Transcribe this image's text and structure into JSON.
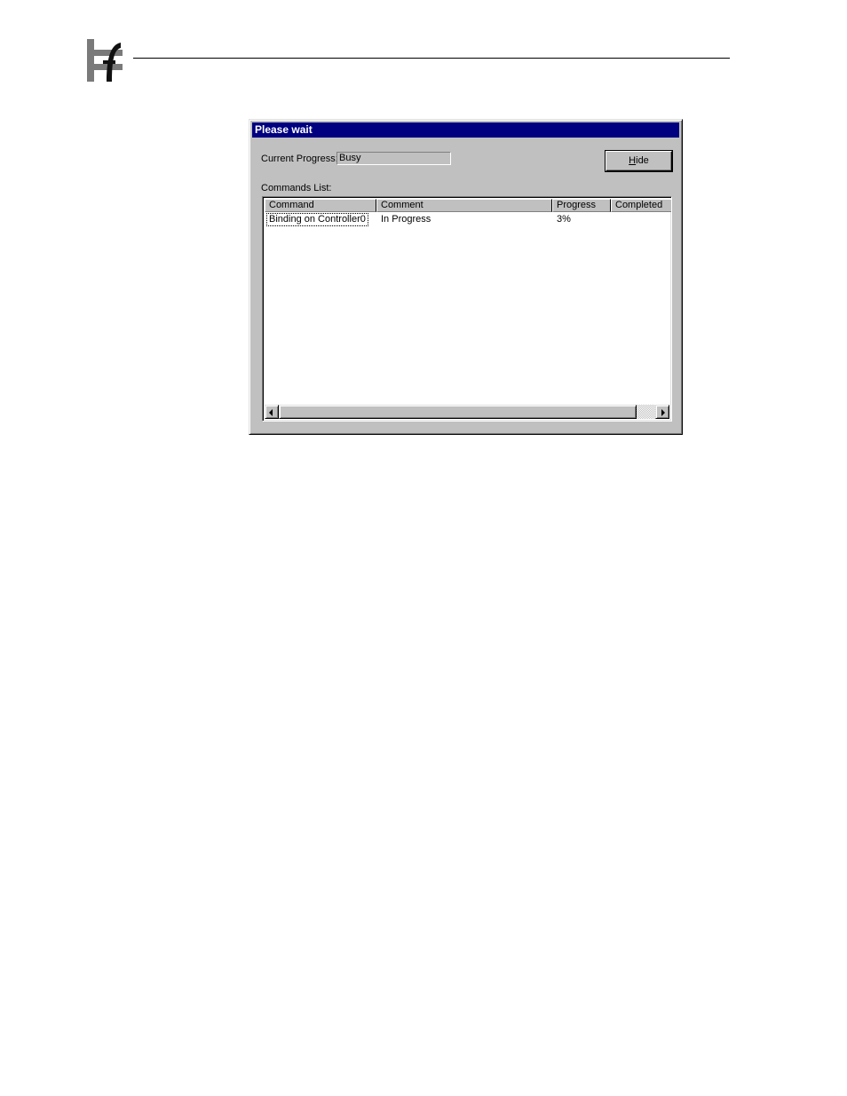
{
  "dialog": {
    "title": "Please wait",
    "current_progress_label": "Current Progress:",
    "current_progress_value": "Busy",
    "hide_button_label": "Hide",
    "hide_button_mnemonic": "H",
    "commands_list_label": "Commands List:"
  },
  "table": {
    "columns": [
      "Command",
      "Comment",
      "Progress",
      "Completed"
    ],
    "rows": [
      {
        "command": "Binding on Controller0",
        "comment": "In Progress",
        "progress": "3%",
        "completed": ""
      }
    ]
  },
  "colors": {
    "titlebar": "#000080",
    "face": "#c0c0c0"
  },
  "icons": [
    "logo-icon",
    "arrow-left-icon",
    "arrow-right-icon"
  ]
}
